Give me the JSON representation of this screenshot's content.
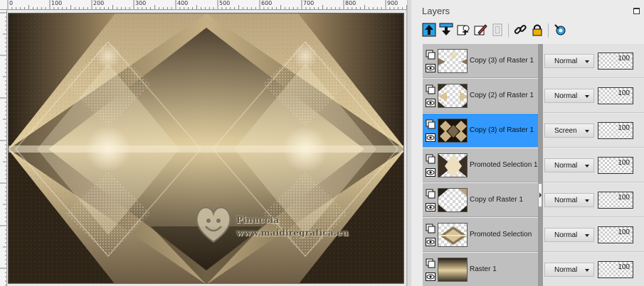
{
  "rulers": {
    "top_ticks": [
      "0",
      "100",
      "200",
      "300",
      "400",
      "500",
      "600",
      "700",
      "800",
      "900"
    ],
    "left_ticks": [
      "0",
      "100",
      "200",
      "300",
      "400",
      "500",
      "600"
    ]
  },
  "canvas": {
    "watermark_name": "Pinuccia",
    "watermark_url": "www.maidiregrafica.eu",
    "colors": {
      "dark": "#2e2417",
      "mid": "#8a7558",
      "light": "#e3cf9f",
      "highlight": "#f4ead0"
    }
  },
  "panel": {
    "title": "Layers",
    "toolbar": [
      {
        "icon": "move-layer-up-icon"
      },
      {
        "icon": "move-layer-down-icon"
      },
      {
        "icon": "new-layer-icon"
      },
      {
        "icon": "edit-layer-icon"
      },
      {
        "icon": "mask-icon"
      },
      {
        "icon": "link-icon"
      },
      {
        "icon": "lock-icon"
      },
      {
        "icon": "group-icon"
      }
    ],
    "selected_color": "#3399ff",
    "layers": [
      {
        "name": "Copy (3) of Raster 1",
        "blend": "Normal",
        "opacity": "100",
        "selected": false
      },
      {
        "name": "Copy (2) of Raster 1",
        "blend": "Normal",
        "opacity": "100",
        "selected": false
      },
      {
        "name": "Copy (3) of Raster 1",
        "blend": "Screen",
        "opacity": "100",
        "selected": true
      },
      {
        "name": "Promoted Selection 1",
        "blend": "Normal",
        "opacity": "100",
        "selected": false
      },
      {
        "name": "Copy of Raster 1",
        "blend": "Normal",
        "opacity": "100",
        "selected": false
      },
      {
        "name": "Promoted Selection",
        "blend": "Normal",
        "opacity": "100",
        "selected": false
      },
      {
        "name": "Raster 1",
        "blend": "Normal",
        "opacity": "100",
        "selected": false
      }
    ]
  }
}
